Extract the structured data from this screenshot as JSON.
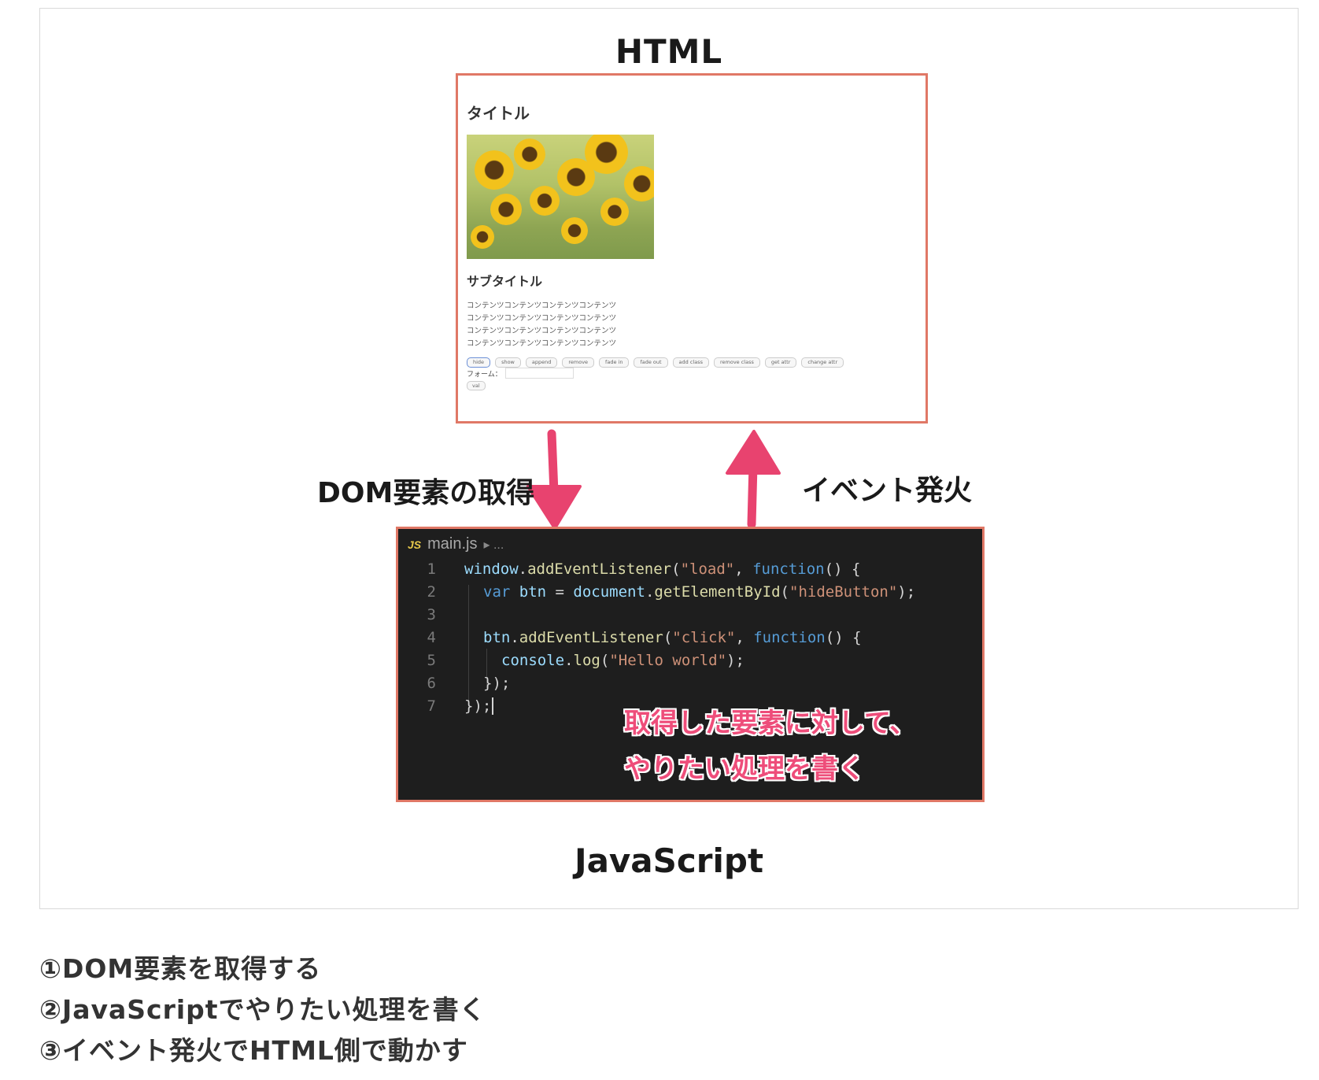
{
  "diagram": {
    "html_label": "HTML",
    "js_label": "JavaScript",
    "arrow_down_label": "DOM要素の取得",
    "arrow_up_label": "イベント発火",
    "arrow_color": "#e8436f",
    "box_border_color": "#e07866"
  },
  "html_preview": {
    "title": "タイトル",
    "subtitle": "サブタイトル",
    "content_lines": [
      "コンテンツコンテンツコンテンツコンテンツ",
      "コンテンツコンテンツコンテンツコンテンツ",
      "コンテンツコンテンツコンテンツコンテンツ",
      "コンテンツコンテンツコンテンツコンテンツ"
    ],
    "buttons": [
      "hide",
      "show",
      "append",
      "remove",
      "fade in",
      "fade out",
      "add class",
      "remove class",
      "get attr",
      "change attr"
    ],
    "form_label": "フォーム：",
    "val_button": "val"
  },
  "code_editor": {
    "js_badge": "JS",
    "file_name": "main.js",
    "breadcrumb": "▸ ...",
    "lines": [
      {
        "num": "1"
      },
      {
        "num": "2"
      },
      {
        "num": "3"
      },
      {
        "num": "4"
      },
      {
        "num": "5"
      },
      {
        "num": "6"
      },
      {
        "num": "7"
      }
    ],
    "tokens": {
      "l1_a": "window",
      "l1_b": ".",
      "l1_c": "addEventListener",
      "l1_d": "(",
      "l1_e": "\"load\"",
      "l1_f": ", ",
      "l1_g": "function",
      "l1_h": "() {",
      "l2_a": "var ",
      "l2_b": "btn",
      "l2_c": " = ",
      "l2_d": "document",
      "l2_e": ".",
      "l2_f": "getElementById",
      "l2_g": "(",
      "l2_h": "\"hideButton\"",
      "l2_i": ");",
      "l4_a": "btn",
      "l4_b": ".",
      "l4_c": "addEventListener",
      "l4_d": "(",
      "l4_e": "\"click\"",
      "l4_f": ", ",
      "l4_g": "function",
      "l4_h": "() {",
      "l5_a": "console",
      "l5_b": ".",
      "l5_c": "log",
      "l5_d": "(",
      "l5_e": "\"Hello world\"",
      "l5_f": ");",
      "l6": "});",
      "l7": "});"
    },
    "note_line1": "取得した要素に対して、",
    "note_line2": "やりたい処理を書く"
  },
  "steps": [
    "①DOM要素を取得する",
    "②JavaScriptでやりたい処理を書く",
    "③イベント発火でHTML側で動かす"
  ]
}
